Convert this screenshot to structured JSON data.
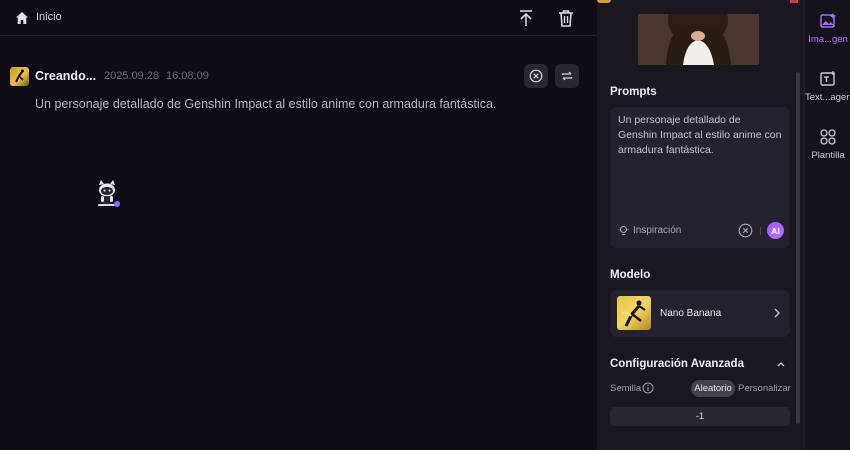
{
  "topbar": {
    "home_label": "Inicio"
  },
  "task": {
    "title": "Creando...",
    "date": "2025.09.28",
    "time": "16:08:09",
    "prompt": "Un personaje detallado de Genshin Impact al estilo anime con armadura fantástica."
  },
  "panel": {
    "prompts_title": "Prompts",
    "prompt_text": "Un personaje detallado de Genshin Impact al estilo anime con armadura fantástica.",
    "inspiration_label": "Inspiración",
    "ai_label": "AI",
    "model_title": "Modelo",
    "model_name": "Nano Banana",
    "advanced_title": "Configuración Avanzada",
    "seed_label": "Semilla",
    "seed_mode_random": "Aleatorio",
    "seed_mode_custom": "Personalizar",
    "seed_value": "-1"
  },
  "rail": {
    "items": [
      {
        "label": "Ima...gen",
        "icon": "image-sparkle-icon",
        "active": true
      },
      {
        "label": "Text...agen",
        "icon": "text-image-icon",
        "active": false
      },
      {
        "label": "Plantilla",
        "icon": "template-grid-icon",
        "active": false
      }
    ]
  },
  "colors": {
    "accent": "#a070ff",
    "background": "#0f0c15",
    "panel": "#1a1720",
    "card": "#252230"
  }
}
